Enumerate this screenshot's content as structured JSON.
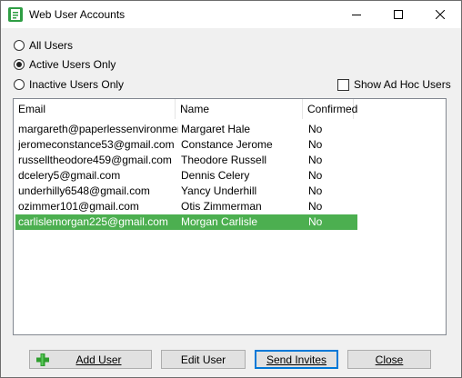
{
  "window": {
    "title": "Web User Accounts",
    "icon": "app-icon"
  },
  "filters": {
    "options": [
      {
        "label": "All Users",
        "checked": false
      },
      {
        "label": "Active Users Only",
        "checked": true
      },
      {
        "label": "Inactive Users Only",
        "checked": false
      }
    ],
    "adhoc_label": "Show Ad Hoc Users",
    "adhoc_checked": false
  },
  "table": {
    "columns": [
      "Email",
      "Name",
      "Confirmed"
    ],
    "rows": [
      {
        "email": "margareth@paperlessenvironmen...",
        "name": "Margaret Hale",
        "confirmed": "No"
      },
      {
        "email": "jeromeconstance53@gmail.com",
        "name": "Constance Jerome",
        "confirmed": "No"
      },
      {
        "email": "russelltheodore459@gmail.com",
        "name": "Theodore Russell",
        "confirmed": "No"
      },
      {
        "email": "dcelery5@gmail.com",
        "name": "Dennis Celery",
        "confirmed": "No"
      },
      {
        "email": "underhilly6548@gmail.com",
        "name": "Yancy Underhill",
        "confirmed": "No"
      },
      {
        "email": "ozimmer101@gmail.com",
        "name": "Otis Zimmerman",
        "confirmed": "No"
      },
      {
        "email": "carlislemorgan225@gmail.com",
        "name": "Morgan Carlisle",
        "confirmed": "No"
      }
    ],
    "selected_row": 6,
    "selection_color": "#4caf50"
  },
  "buttons": {
    "add_user": "Add User",
    "edit_user": "Edit User",
    "send_invites": "Send Invites",
    "close": "Close"
  },
  "colors": {
    "accent": "#0078d7",
    "add_icon": "#2e9e2e"
  }
}
